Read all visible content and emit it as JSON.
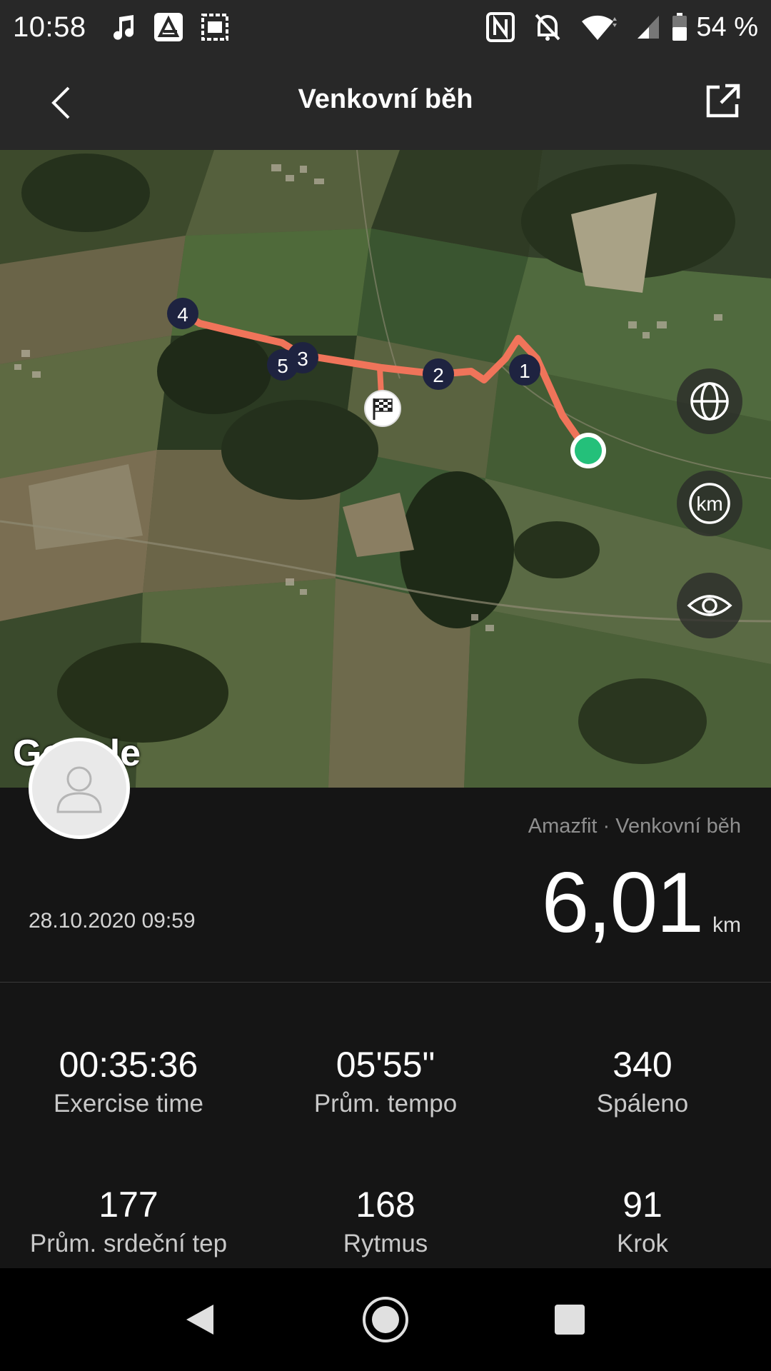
{
  "status_bar": {
    "time": "10:58",
    "battery_percent": "54 %",
    "icons_left": [
      "music-note-icon",
      "app-a-icon",
      "image-icon"
    ],
    "icons_right": [
      "nfc-icon",
      "bell-off-icon",
      "wifi-icon",
      "signal-icon",
      "battery-icon"
    ]
  },
  "app_bar": {
    "title": "Venkovní běh"
  },
  "map": {
    "attribution": "Google",
    "route_color": "#f0745a",
    "start_color": "#24c07a",
    "km_markers": [
      "1",
      "2",
      "3",
      "4",
      "5"
    ],
    "controls": [
      "globe-icon",
      "km-icon",
      "eye-icon"
    ],
    "km_control_label": "km"
  },
  "summary": {
    "source": "Amazfit · Venkovní běh",
    "distance": "6,01",
    "distance_unit": "km",
    "date": "28.10.2020 09:59"
  },
  "stats": [
    {
      "value": "00:35:36",
      "label": "Exercise time"
    },
    {
      "value": "05'55\"",
      "label": "Prům. tempo"
    },
    {
      "value": "340",
      "label": "Spáleno"
    },
    {
      "value": "177",
      "label": "Prům. srdeční tep"
    },
    {
      "value": "168",
      "label": "Rytmus"
    },
    {
      "value": "91",
      "label": "Krok"
    }
  ],
  "nav_bar": [
    "back-triangle-icon",
    "home-circle-icon",
    "recents-square-icon"
  ]
}
